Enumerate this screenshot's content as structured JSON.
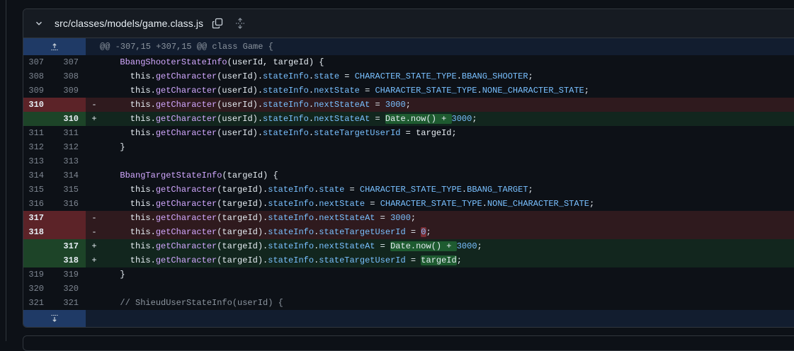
{
  "file": {
    "path": "src/classes/models/game.class.js",
    "hunk_header": "@@ -307,15 +307,15 @@ class Game {"
  },
  "icons": {
    "collapse": "chevron-down-icon",
    "copy": "copy-icon",
    "expand_all": "unfold-icon",
    "expand_up": "expand-up-icon",
    "expand_down": "expand-down-icon"
  },
  "colors": {
    "deletion_bg": "#2f1a1e",
    "addition_bg": "#12261e",
    "function": "#d2a8ff",
    "property": "#79c0ff"
  },
  "lines": [
    {
      "type": "ctx",
      "old": "307",
      "new": "307",
      "sign": "",
      "tokens": [
        [
          "t",
          "  "
        ],
        [
          "fn",
          "BbangShooterStateInfo"
        ],
        [
          "t",
          "(userId, targeId) {"
        ]
      ]
    },
    {
      "type": "ctx",
      "old": "308",
      "new": "308",
      "sign": "",
      "tokens": [
        [
          "t",
          "    this."
        ],
        [
          "fn",
          "getCharacter"
        ],
        [
          "t",
          "(userId)."
        ],
        [
          "pr",
          "stateInfo"
        ],
        [
          "t",
          "."
        ],
        [
          "pr",
          "state"
        ],
        [
          "t",
          " = "
        ],
        [
          "cst",
          "CHARACTER_STATE_TYPE"
        ],
        [
          "t",
          "."
        ],
        [
          "cst",
          "BBANG_SHOOTER"
        ],
        [
          "t",
          ";"
        ]
      ]
    },
    {
      "type": "ctx",
      "old": "309",
      "new": "309",
      "sign": "",
      "tokens": [
        [
          "t",
          "    this."
        ],
        [
          "fn",
          "getCharacter"
        ],
        [
          "t",
          "(userId)."
        ],
        [
          "pr",
          "stateInfo"
        ],
        [
          "t",
          "."
        ],
        [
          "pr",
          "nextState"
        ],
        [
          "t",
          " = "
        ],
        [
          "cst",
          "CHARACTER_STATE_TYPE"
        ],
        [
          "t",
          "."
        ],
        [
          "cst",
          "NONE_CHARACTER_STATE"
        ],
        [
          "t",
          ";"
        ]
      ]
    },
    {
      "type": "del",
      "old": "310",
      "new": "",
      "sign": "-",
      "tokens": [
        [
          "t",
          "    this."
        ],
        [
          "fn",
          "getCharacter"
        ],
        [
          "t",
          "(userId)."
        ],
        [
          "pr",
          "stateInfo"
        ],
        [
          "t",
          "."
        ],
        [
          "pr",
          "nextStateAt"
        ],
        [
          "t",
          " = "
        ],
        [
          "nm",
          "3000"
        ],
        [
          "t",
          ";"
        ]
      ]
    },
    {
      "type": "add",
      "old": "",
      "new": "310",
      "sign": "+",
      "tokens": [
        [
          "t",
          "    this."
        ],
        [
          "fn",
          "getCharacter"
        ],
        [
          "t",
          "(userId)."
        ],
        [
          "pr",
          "stateInfo"
        ],
        [
          "t",
          "."
        ],
        [
          "pr",
          "nextStateAt"
        ],
        [
          "t",
          " = "
        ],
        [
          "hla",
          "Date.now() + "
        ],
        [
          "nm",
          "3000"
        ],
        [
          "t",
          ";"
        ]
      ]
    },
    {
      "type": "ctx",
      "old": "311",
      "new": "311",
      "sign": "",
      "tokens": [
        [
          "t",
          "    this."
        ],
        [
          "fn",
          "getCharacter"
        ],
        [
          "t",
          "(userId)."
        ],
        [
          "pr",
          "stateInfo"
        ],
        [
          "t",
          "."
        ],
        [
          "pr",
          "stateTargetUserId"
        ],
        [
          "t",
          " = targeId;"
        ]
      ]
    },
    {
      "type": "ctx",
      "old": "312",
      "new": "312",
      "sign": "",
      "tokens": [
        [
          "t",
          "  }"
        ]
      ]
    },
    {
      "type": "ctx",
      "old": "313",
      "new": "313",
      "sign": "",
      "tokens": [
        [
          "t",
          ""
        ]
      ]
    },
    {
      "type": "ctx",
      "old": "314",
      "new": "314",
      "sign": "",
      "tokens": [
        [
          "t",
          "  "
        ],
        [
          "fn",
          "BbangTargetStateInfo"
        ],
        [
          "t",
          "(targeId) {"
        ]
      ]
    },
    {
      "type": "ctx",
      "old": "315",
      "new": "315",
      "sign": "",
      "tokens": [
        [
          "t",
          "    this."
        ],
        [
          "fn",
          "getCharacter"
        ],
        [
          "t",
          "(targeId)."
        ],
        [
          "pr",
          "stateInfo"
        ],
        [
          "t",
          "."
        ],
        [
          "pr",
          "state"
        ],
        [
          "t",
          " = "
        ],
        [
          "cst",
          "CHARACTER_STATE_TYPE"
        ],
        [
          "t",
          "."
        ],
        [
          "cst",
          "BBANG_TARGET"
        ],
        [
          "t",
          ";"
        ]
      ]
    },
    {
      "type": "ctx",
      "old": "316",
      "new": "316",
      "sign": "",
      "tokens": [
        [
          "t",
          "    this."
        ],
        [
          "fn",
          "getCharacter"
        ],
        [
          "t",
          "(targeId)."
        ],
        [
          "pr",
          "stateInfo"
        ],
        [
          "t",
          "."
        ],
        [
          "pr",
          "nextState"
        ],
        [
          "t",
          " = "
        ],
        [
          "cst",
          "CHARACTER_STATE_TYPE"
        ],
        [
          "t",
          "."
        ],
        [
          "cst",
          "NONE_CHARACTER_STATE"
        ],
        [
          "t",
          ";"
        ]
      ]
    },
    {
      "type": "del",
      "old": "317",
      "new": "",
      "sign": "-",
      "tokens": [
        [
          "t",
          "    this."
        ],
        [
          "fn",
          "getCharacter"
        ],
        [
          "t",
          "(targeId)."
        ],
        [
          "pr",
          "stateInfo"
        ],
        [
          "t",
          "."
        ],
        [
          "pr",
          "nextStateAt"
        ],
        [
          "t",
          " = "
        ],
        [
          "nm",
          "3000"
        ],
        [
          "t",
          ";"
        ]
      ]
    },
    {
      "type": "del",
      "old": "318",
      "new": "",
      "sign": "-",
      "tokens": [
        [
          "t",
          "    this."
        ],
        [
          "fn",
          "getCharacter"
        ],
        [
          "t",
          "(targeId)."
        ],
        [
          "pr",
          "stateInfo"
        ],
        [
          "t",
          "."
        ],
        [
          "pr",
          "stateTargetUserId"
        ],
        [
          "t",
          " = "
        ],
        [
          "hld",
          "0"
        ],
        [
          "t",
          ";"
        ]
      ]
    },
    {
      "type": "add",
      "old": "",
      "new": "317",
      "sign": "+",
      "tokens": [
        [
          "t",
          "    this."
        ],
        [
          "fn",
          "getCharacter"
        ],
        [
          "t",
          "(targeId)."
        ],
        [
          "pr",
          "stateInfo"
        ],
        [
          "t",
          "."
        ],
        [
          "pr",
          "nextStateAt"
        ],
        [
          "t",
          " = "
        ],
        [
          "hla",
          "Date.now() + "
        ],
        [
          "nm",
          "3000"
        ],
        [
          "t",
          ";"
        ]
      ]
    },
    {
      "type": "add",
      "old": "",
      "new": "318",
      "sign": "+",
      "tokens": [
        [
          "t",
          "    this."
        ],
        [
          "fn",
          "getCharacter"
        ],
        [
          "t",
          "(targeId)."
        ],
        [
          "pr",
          "stateInfo"
        ],
        [
          "t",
          "."
        ],
        [
          "pr",
          "stateTargetUserId"
        ],
        [
          "t",
          " = "
        ],
        [
          "hla",
          "targeId"
        ],
        [
          "t",
          ";"
        ]
      ]
    },
    {
      "type": "ctx",
      "old": "319",
      "new": "319",
      "sign": "",
      "tokens": [
        [
          "t",
          "  }"
        ]
      ]
    },
    {
      "type": "ctx",
      "old": "320",
      "new": "320",
      "sign": "",
      "tokens": [
        [
          "t",
          ""
        ]
      ]
    },
    {
      "type": "ctx",
      "old": "321",
      "new": "321",
      "sign": "",
      "tokens": [
        [
          "t",
          "  "
        ],
        [
          "cm",
          "// ShieudUserStateInfo(userId) {"
        ]
      ]
    }
  ]
}
